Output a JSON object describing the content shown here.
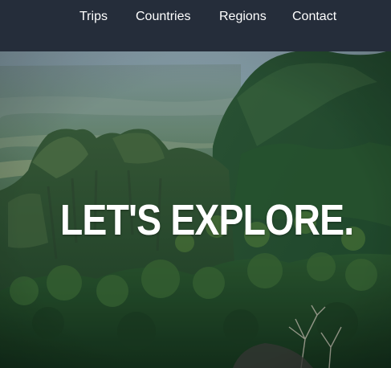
{
  "nav": {
    "items": [
      {
        "label": "Trips"
      },
      {
        "label": "Countries"
      },
      {
        "label": "Regions"
      },
      {
        "label": "Contact"
      }
    ]
  },
  "hero": {
    "title": "LET'S EXPLORE."
  },
  "colors": {
    "navbar_bg": "#252d3a",
    "nav_text": "#ffffff",
    "hero_text": "#ffffff"
  }
}
